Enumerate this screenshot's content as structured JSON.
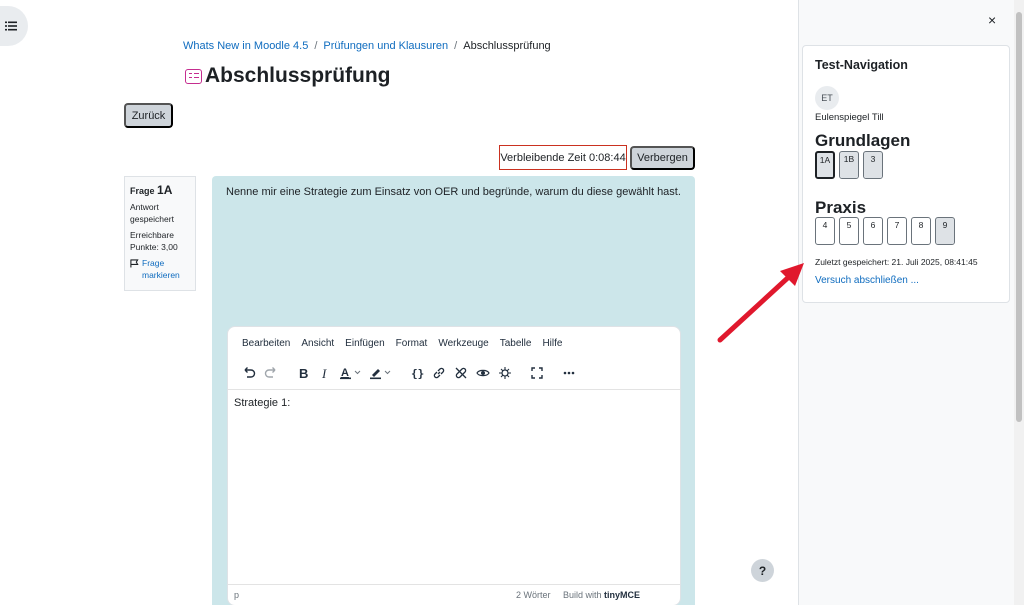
{
  "breadcrumb": {
    "items": [
      "Whats New in Moodle 4.5",
      "Prüfungen und Klausuren"
    ],
    "current": "Abschlussprüfung",
    "separator": "/"
  },
  "page": {
    "title": "Abschlussprüfung",
    "back_label": "Zurück",
    "timer_label": "Verbleibende Zeit 0:08:44",
    "hide_label": "Verbergen",
    "help_label": "?"
  },
  "question_info": {
    "prefix": "Frage",
    "number": "1A",
    "status": "Antwort gespeichert",
    "points": "Erreichbare Punkte: 3,00",
    "flag_label": "Frage markieren"
  },
  "question": {
    "text": "Nenne mir eine Strategie zum Einsatz von OER und begründe, warum du diese gewählt hast."
  },
  "editor": {
    "menu": [
      "Bearbeiten",
      "Ansicht",
      "Einfügen",
      "Format",
      "Werkzeuge",
      "Tabelle",
      "Hilfe"
    ],
    "content": "Strategie 1:",
    "status_path": "p",
    "word_count": "2 Wörter",
    "build_prefix": "Build with",
    "build_brand": "tinyMCE"
  },
  "drawer": {
    "close_label": "×",
    "nav_title": "Test-Navigation",
    "user_initials": "ET",
    "user_name": "Eulenspiegel Till",
    "sections": [
      {
        "title": "Grundlagen",
        "questions": [
          "1A",
          "1B",
          "3"
        ]
      },
      {
        "title": "Praxis",
        "questions": [
          "4",
          "5",
          "6",
          "7",
          "8",
          "9"
        ]
      }
    ],
    "saved_info": "Zuletzt gespeichert: 21. Juli 2025, 08:41:45",
    "finish_label": "Versuch abschließen ..."
  },
  "colors": {
    "accent": "#0f6cbf",
    "title_icon": "#c52d8f",
    "question_bg": "#cce6ea",
    "timer_border": "#ca3120",
    "arrow": "#e0182d"
  }
}
